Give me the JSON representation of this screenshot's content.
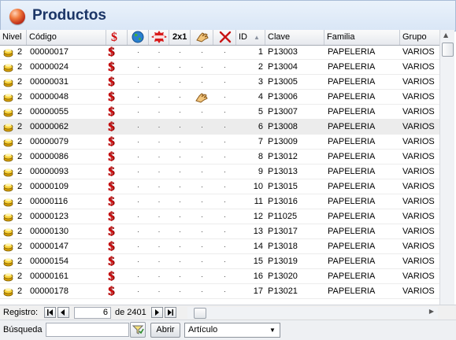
{
  "window": {
    "title": "Productos"
  },
  "columns": {
    "nivel": "Nivel",
    "codigo": "Código",
    "id": "ID",
    "id_sort_icon": "sort-ascending-icon",
    "clave": "Clave",
    "familia": "Familia",
    "grupo": "Grupo",
    "icons": [
      "dollar-icon",
      "globe-icon",
      "new-badge-icon",
      "two-for-one-icon",
      "hand-icon",
      "red-x-icon"
    ],
    "two_for_one_label": "2x1"
  },
  "rows": [
    {
      "nivel": "2",
      "codigo": "00000017",
      "d1": "·",
      "d2": "·",
      "d3": "·",
      "d4": "·",
      "d5": "·",
      "id": "1",
      "clave": "P13003",
      "familia": "PAPELERIA",
      "grupo": "VARIOS"
    },
    {
      "nivel": "2",
      "codigo": "00000024",
      "d1": "·",
      "d2": "·",
      "d3": "·",
      "d4": "·",
      "d5": "·",
      "id": "2",
      "clave": "P13004",
      "familia": "PAPELERIA",
      "grupo": "VARIOS"
    },
    {
      "nivel": "2",
      "codigo": "00000031",
      "d1": "·",
      "d2": "·",
      "d3": "·",
      "d4": "·",
      "d5": "·",
      "id": "3",
      "clave": "P13005",
      "familia": "PAPELERIA",
      "grupo": "VARIOS"
    },
    {
      "nivel": "2",
      "codigo": "00000048",
      "d1": "·",
      "d2": "·",
      "d3": "·",
      "d4": "hand",
      "d5": "·",
      "id": "4",
      "clave": "P13006",
      "familia": "PAPELERIA",
      "grupo": "VARIOS"
    },
    {
      "nivel": "2",
      "codigo": "00000055",
      "d1": "·",
      "d2": "·",
      "d3": "·",
      "d4": "·",
      "d5": "·",
      "id": "5",
      "clave": "P13007",
      "familia": "PAPELERIA",
      "grupo": "VARIOS"
    },
    {
      "nivel": "2",
      "codigo": "00000062",
      "d1": "·",
      "d2": "·",
      "d3": "·",
      "d4": "·",
      "d5": "·",
      "id": "6",
      "clave": "P13008",
      "familia": "PAPELERIA",
      "grupo": "VARIOS",
      "selected": true
    },
    {
      "nivel": "2",
      "codigo": "00000079",
      "d1": "·",
      "d2": "·",
      "d3": "·",
      "d4": "·",
      "d5": "·",
      "id": "7",
      "clave": "P13009",
      "familia": "PAPELERIA",
      "grupo": "VARIOS"
    },
    {
      "nivel": "2",
      "codigo": "00000086",
      "d1": "·",
      "d2": "·",
      "d3": "·",
      "d4": "·",
      "d5": "·",
      "id": "8",
      "clave": "P13012",
      "familia": "PAPELERIA",
      "grupo": "VARIOS"
    },
    {
      "nivel": "2",
      "codigo": "00000093",
      "d1": "·",
      "d2": "·",
      "d3": "·",
      "d4": "·",
      "d5": "·",
      "id": "9",
      "clave": "P13013",
      "familia": "PAPELERIA",
      "grupo": "VARIOS"
    },
    {
      "nivel": "2",
      "codigo": "00000109",
      "d1": "·",
      "d2": "·",
      "d3": "·",
      "d4": "·",
      "d5": "·",
      "id": "10",
      "clave": "P13015",
      "familia": "PAPELERIA",
      "grupo": "VARIOS"
    },
    {
      "nivel": "2",
      "codigo": "00000116",
      "d1": "·",
      "d2": "·",
      "d3": "·",
      "d4": "·",
      "d5": "·",
      "id": "11",
      "clave": "P13016",
      "familia": "PAPELERIA",
      "grupo": "VARIOS"
    },
    {
      "nivel": "2",
      "codigo": "00000123",
      "d1": "·",
      "d2": "·",
      "d3": "·",
      "d4": "·",
      "d5": "·",
      "id": "12",
      "clave": "P11025",
      "familia": "PAPELERIA",
      "grupo": "VARIOS"
    },
    {
      "nivel": "2",
      "codigo": "00000130",
      "d1": "·",
      "d2": "·",
      "d3": "·",
      "d4": "·",
      "d5": "·",
      "id": "13",
      "clave": "P13017",
      "familia": "PAPELERIA",
      "grupo": "VARIOS"
    },
    {
      "nivel": "2",
      "codigo": "00000147",
      "d1": "·",
      "d2": "·",
      "d3": "·",
      "d4": "·",
      "d5": "·",
      "id": "14",
      "clave": "P13018",
      "familia": "PAPELERIA",
      "grupo": "VARIOS"
    },
    {
      "nivel": "2",
      "codigo": "00000154",
      "d1": "·",
      "d2": "·",
      "d3": "·",
      "d4": "·",
      "d5": "·",
      "id": "15",
      "clave": "P13019",
      "familia": "PAPELERIA",
      "grupo": "VARIOS"
    },
    {
      "nivel": "2",
      "codigo": "00000161",
      "d1": "·",
      "d2": "·",
      "d3": "·",
      "d4": "·",
      "d5": "·",
      "id": "16",
      "clave": "P13020",
      "familia": "PAPELERIA",
      "grupo": "VARIOS"
    },
    {
      "nivel": "2",
      "codigo": "00000178",
      "d1": "·",
      "d2": "·",
      "d3": "·",
      "d4": "·",
      "d5": "·",
      "id": "17",
      "clave": "P13021",
      "familia": "PAPELERIA",
      "grupo": "VARIOS"
    }
  ],
  "navigation": {
    "label": "Registro:",
    "current": "6",
    "of_label": "de 2401"
  },
  "search": {
    "label": "Búsqueda",
    "value": "",
    "open_label": "Abrir",
    "type_value": "Artículo"
  },
  "colors": {
    "title_text": "#1b3566",
    "dollar_red": "#d10f10",
    "selected_row": "#ececec"
  }
}
